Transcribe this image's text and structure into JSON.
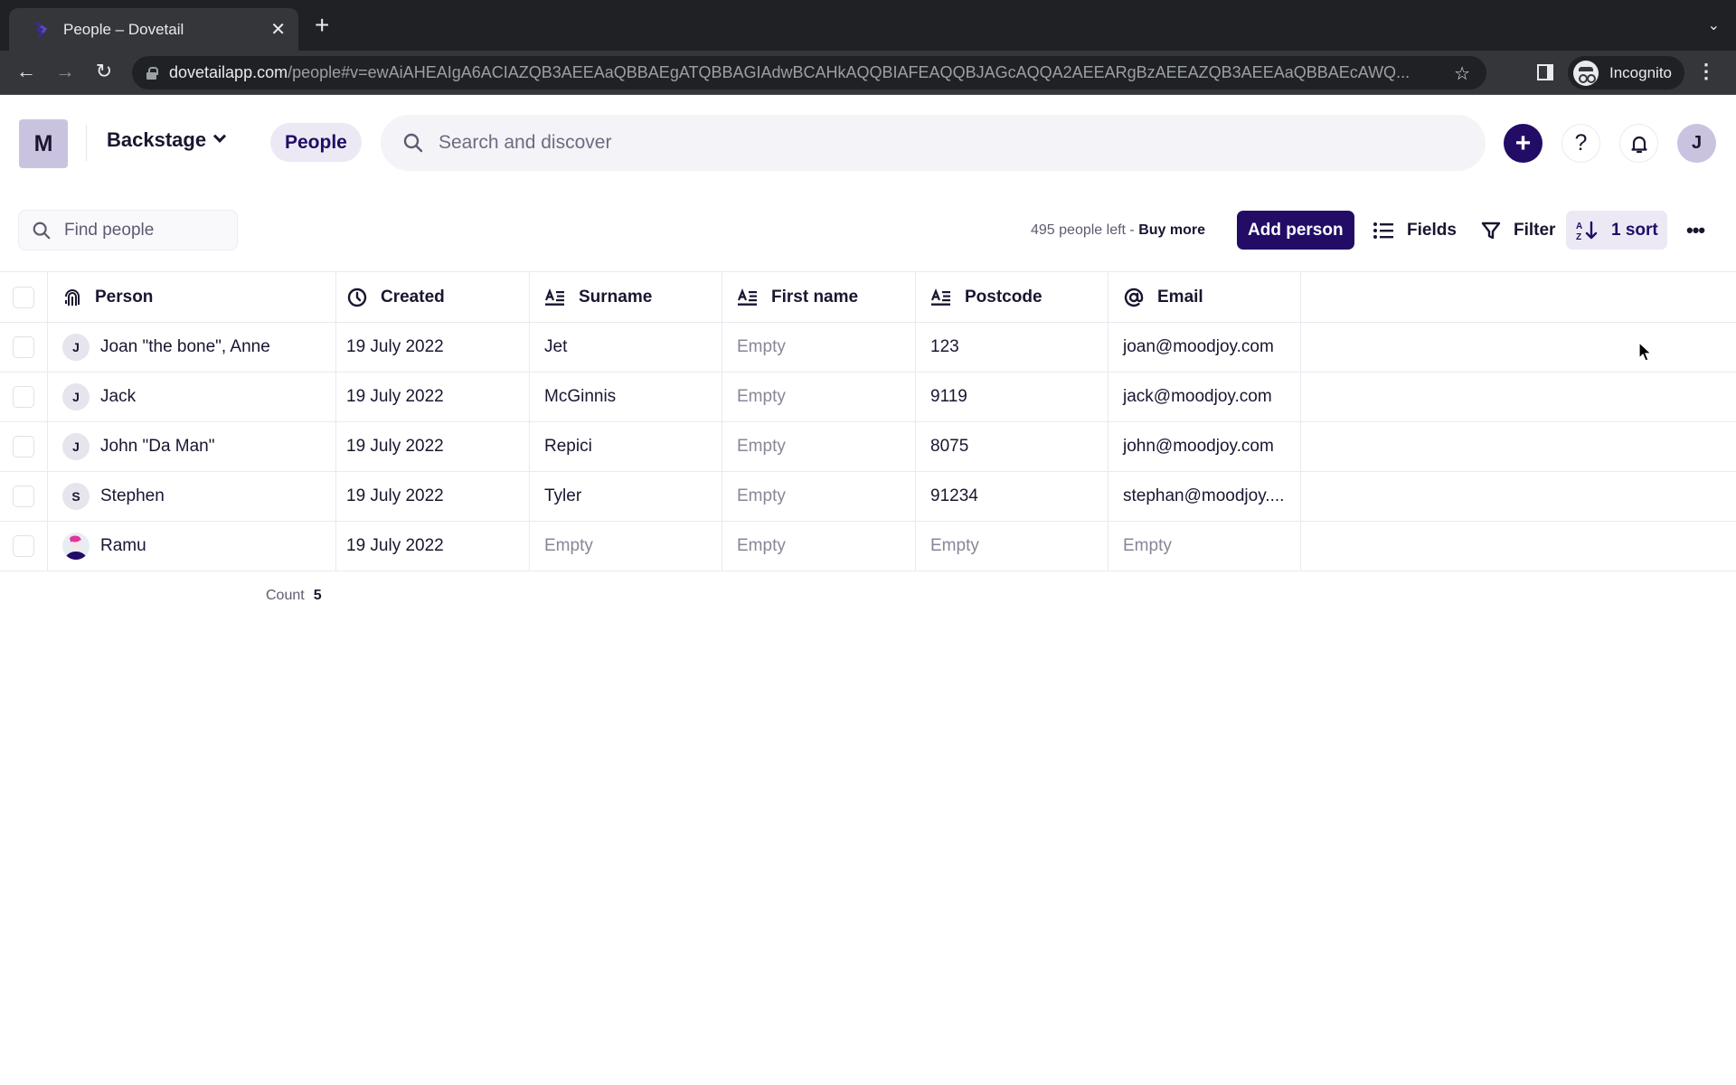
{
  "browser": {
    "tab_title": "People – Dovetail",
    "url_host": "dovetailapp.com",
    "url_path": "/people#v=ewAiAHEAIgA6ACIAZQB3AEEAaQBBAEgATQBBAGIAdwBCAHkAQQBIAFEAQQBJAGcAQQA2AEEARgBzAEEAZQB3AEEAaQBBAEcAWQ...",
    "profile_label": "Incognito"
  },
  "header": {
    "workspace_initial": "M",
    "workspace_name": "Backstage",
    "nav_active": "People",
    "search_placeholder": "Search and discover",
    "user_initial": "J",
    "help_glyph": "?",
    "add_glyph": "+"
  },
  "toolbar": {
    "find_placeholder": "Find people",
    "quota_text": "495 people left - ",
    "buy_more": "Buy more",
    "add_person": "Add person",
    "fields": "Fields",
    "filter": "Filter",
    "sort": "1 sort",
    "more": "•••"
  },
  "table": {
    "columns": [
      {
        "label": "Person",
        "icon": "fingerprint-icon"
      },
      {
        "label": "Created",
        "icon": "clock-icon"
      },
      {
        "label": "Surname",
        "icon": "text-field-icon"
      },
      {
        "label": "First name",
        "icon": "text-field-icon"
      },
      {
        "label": "Postcode",
        "icon": "text-field-icon"
      },
      {
        "label": "Email",
        "icon": "at-sign-icon"
      }
    ],
    "rows": [
      {
        "initial": "J",
        "person": "Joan \"the bone\", Anne",
        "created": "19 July 2022",
        "surname": "Jet",
        "first_name": "Empty",
        "postcode": "123",
        "email": "joan@moodjoy.com"
      },
      {
        "initial": "J",
        "person": "Jack",
        "created": "19 July 2022",
        "surname": "McGinnis",
        "first_name": "Empty",
        "postcode": "9119",
        "email": "jack@moodjoy.com"
      },
      {
        "initial": "J",
        "person": "John \"Da Man\"",
        "created": "19 July 2022",
        "surname": "Repici",
        "first_name": "Empty",
        "postcode": "8075",
        "email": "john@moodjoy.com"
      },
      {
        "initial": "S",
        "person": "Stephen",
        "created": "19 July 2022",
        "surname": "Tyler",
        "first_name": "Empty",
        "postcode": "91234",
        "email": "stephan@moodjoy...."
      },
      {
        "initial": "",
        "person": "Ramu",
        "created": "19 July 2022",
        "surname": "Empty",
        "first_name": "Empty",
        "postcode": "Empty",
        "email": "Empty"
      }
    ],
    "empty_value": "Empty",
    "count_label": "Count",
    "count_value": "5"
  },
  "colors": {
    "brand_primary": "#220c66",
    "pill_bg": "#ece9f5",
    "avatar_bg": "#c9c3e0"
  }
}
